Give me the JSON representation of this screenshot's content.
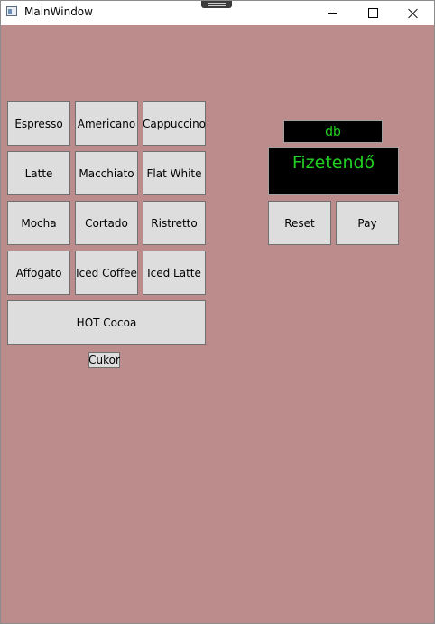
{
  "window": {
    "title": "MainWindow"
  },
  "drinks": [
    "Espresso",
    "Americano",
    "Cappuccino",
    "Latte",
    "Macchiato",
    "Flat White",
    "Mocha",
    "Cortado",
    "Ristretto",
    "Affogato",
    "Iced Coffee",
    "Iced Latte"
  ],
  "hot_cocoa_label": "HOT Cocoa",
  "sugar_label": "Cukor",
  "display": {
    "count_label": "db",
    "total_label": "Fizetendő"
  },
  "actions": {
    "reset_label": "Reset",
    "pay_label": "Pay"
  },
  "colors": {
    "window_background": "#bc8c8c",
    "display_text": "#22d022",
    "display_background": "#000000",
    "button_background": "#dddddd"
  }
}
